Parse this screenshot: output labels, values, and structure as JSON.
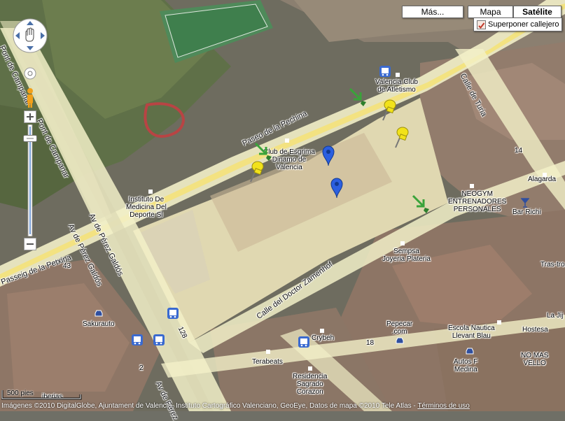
{
  "map_types": {
    "more": "Más...",
    "map": "Mapa",
    "satellite": "Satélite",
    "active": "satellite"
  },
  "overlay": {
    "label": "Superponer callejero",
    "checked": true
  },
  "controls": {
    "pan": "pan-control",
    "zoom_in": "+",
    "zoom_out": "−",
    "pegman": "pegman"
  },
  "streets": {
    "pont_campanar_1": "Pont de Campanar",
    "pont_campanar_2": "Pont de Campanar",
    "paseo_pechina": "Paseo de la Pechina",
    "passeig_petxina": "Passeig de la Petxina",
    "av_perez_galdos_1": "Av de Pérez Galdós",
    "av_perez_galdos_2": "Av de Pérez Galdós",
    "av_perez_galdos_3": "Av de Pérez",
    "calle_doctor_zamenhof": "Calle del Doctor Zamenhof",
    "calle_turia": "Calle de Turia",
    "num_43": "43",
    "num_14": "14",
    "num_18": "18",
    "num_2": "2",
    "num_128": "128"
  },
  "places": {
    "valencia_club": "Valencia Club\nde Atletismo",
    "club_esgrima": "Club de Esgrima\nDinamo de\nValencia",
    "instituto_medicina": "Instituto De\nMedicina Del\nDeporte Sl",
    "neogym": "NEOGYM\nENTRENADORES\nPERSONALES",
    "alagarda": "Alagarda",
    "bar_richi": "Bar Richi",
    "tras_tro": "Tras-tro",
    "sempsa": "Sempsa\nJoyeria Plateria",
    "sakurauto": "Sakurauto",
    "crybeh": "Crybeh",
    "pepecar": "Pepecar\n.com",
    "escola_nautica": "Escola Nautica\nLlevant Blau",
    "hostesa": "Hostesa",
    "autos_medina": "Autos F\nMedina",
    "no_mas_vello": "NO MAS\nVELLO",
    "terabeats": "Terabeats",
    "residencia": "Residencia\nSagrado\nCorazon",
    "la_jij": "La Jij",
    "iberias": "iberias"
  },
  "scale": {
    "label": "500 pies"
  },
  "copyright": {
    "text": "Imágenes ©2010 DigitalGlobe, Ajuntament de Valencia, Instituto Cartográfico Valenciano, GeoEye, Datos de mapa ©2010 Tele Atlas - ",
    "terms": "Términos de uso"
  },
  "colors": {
    "road": "#f2f0c8",
    "highway": "#f4e27a",
    "highlight": "#f5edc0",
    "marker_blue": "#2b5fe0",
    "pushpin_yellow": "#f2e21a",
    "arrow_green": "#3aa33a"
  }
}
